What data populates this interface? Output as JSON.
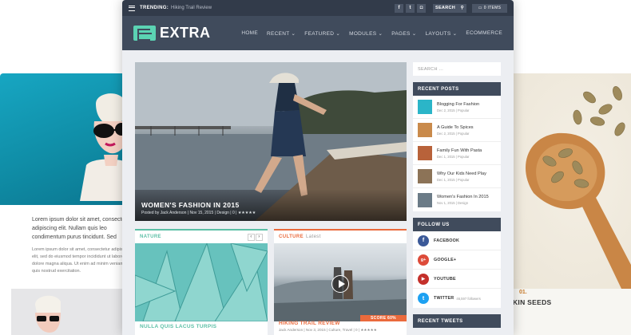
{
  "topbar": {
    "trending_label": "TRENDING:",
    "trending_text": "Hiking Trail Review",
    "social_icons": [
      "facebook-icon",
      "twitter-icon",
      "instagram-icon"
    ],
    "search_label": "SEARCH",
    "cart_label": "0 ITEMS"
  },
  "nav": {
    "logo_text": "EXTRA",
    "items": [
      "HOME",
      "RECENT ⌄",
      "FEATURED ⌄",
      "MODULES ⌄",
      "PAGES ⌄",
      "LAYOUTS ⌄",
      "ECOMMERCE"
    ]
  },
  "hero": {
    "title": "WOMEN'S FASHION IN 2015",
    "meta": "Posted by Jack Anderson | Nov 15, 2015 | Design | 0 | ★★★★★"
  },
  "cards": {
    "left": {
      "category": "NATURE",
      "title": "NULLA QUIS LACUS TURPIS",
      "prev": "‹",
      "next": "›"
    },
    "right": {
      "category": "CULTURE",
      "subcategory": "Latest",
      "score": "SCORE 60%",
      "title": "HIKING TRAIL REVIEW",
      "meta": "Jack Anderson | Nov 3, 2015 | Culture, Travel | 0 | ★★★★★"
    }
  },
  "sidebar": {
    "search_placeholder": "SEARCH ...",
    "recent_posts_title": "RECENT POSTS",
    "recent_posts": [
      {
        "title": "Blogging For Fashion",
        "meta": "Dec 2, 2015 | Popular",
        "color": "#2bb5c8"
      },
      {
        "title": "A Guide To Spices",
        "meta": "Dec 2, 2015 | Popular",
        "color": "#c98a4b"
      },
      {
        "title": "Family Fun With Pasta",
        "meta": "Dec 1, 2015 | Popular",
        "color": "#b8623a"
      },
      {
        "title": "Why Our Kids Need Play",
        "meta": "Dec 1, 2015 | Popular",
        "color": "#8c7357"
      },
      {
        "title": "Women's Fashion In 2015",
        "meta": "Nov 1, 2015 | Design",
        "color": "#6b7b87"
      }
    ],
    "follow_title": "FOLLOW US",
    "follow": [
      {
        "label": "FACEBOOK",
        "glyph": "f",
        "color": "#3b5998",
        "count": ""
      },
      {
        "label": "GOOGLE+",
        "glyph": "g+",
        "color": "#dd4b39",
        "count": ""
      },
      {
        "label": "YOUTUBE",
        "glyph": "▶",
        "color": "#c4302b",
        "count": ""
      },
      {
        "label": "TWITTER",
        "glyph": "t",
        "color": "#1da1f2",
        "count": "46,597 followers"
      }
    ],
    "recent_tweets_title": "RECENT TWEETS"
  },
  "left_page": {
    "headline": "Lorem ipsum dolor sit amet, consectetur adipiscing elit. Nullam quis leo condimentum purus tincidunt. Sed lacinia imperdiet, sodales et sem. Lorem ipsum dolor sit amet, consectetur adipiscing elit, sed do eiusmod tempor incididunt ut labore et dolore magna aliqua.",
    "body": "Lorem ipsum dolor sit amet, consectetur adipiscing elit, sed do eiusmod tempor incididunt ut labore et dolore magna aliqua. Ut enim ad minim veniam, quis nostrud exercitation."
  },
  "right_page": {
    "number": "01.",
    "caption": "PKIN SEEDS"
  }
}
